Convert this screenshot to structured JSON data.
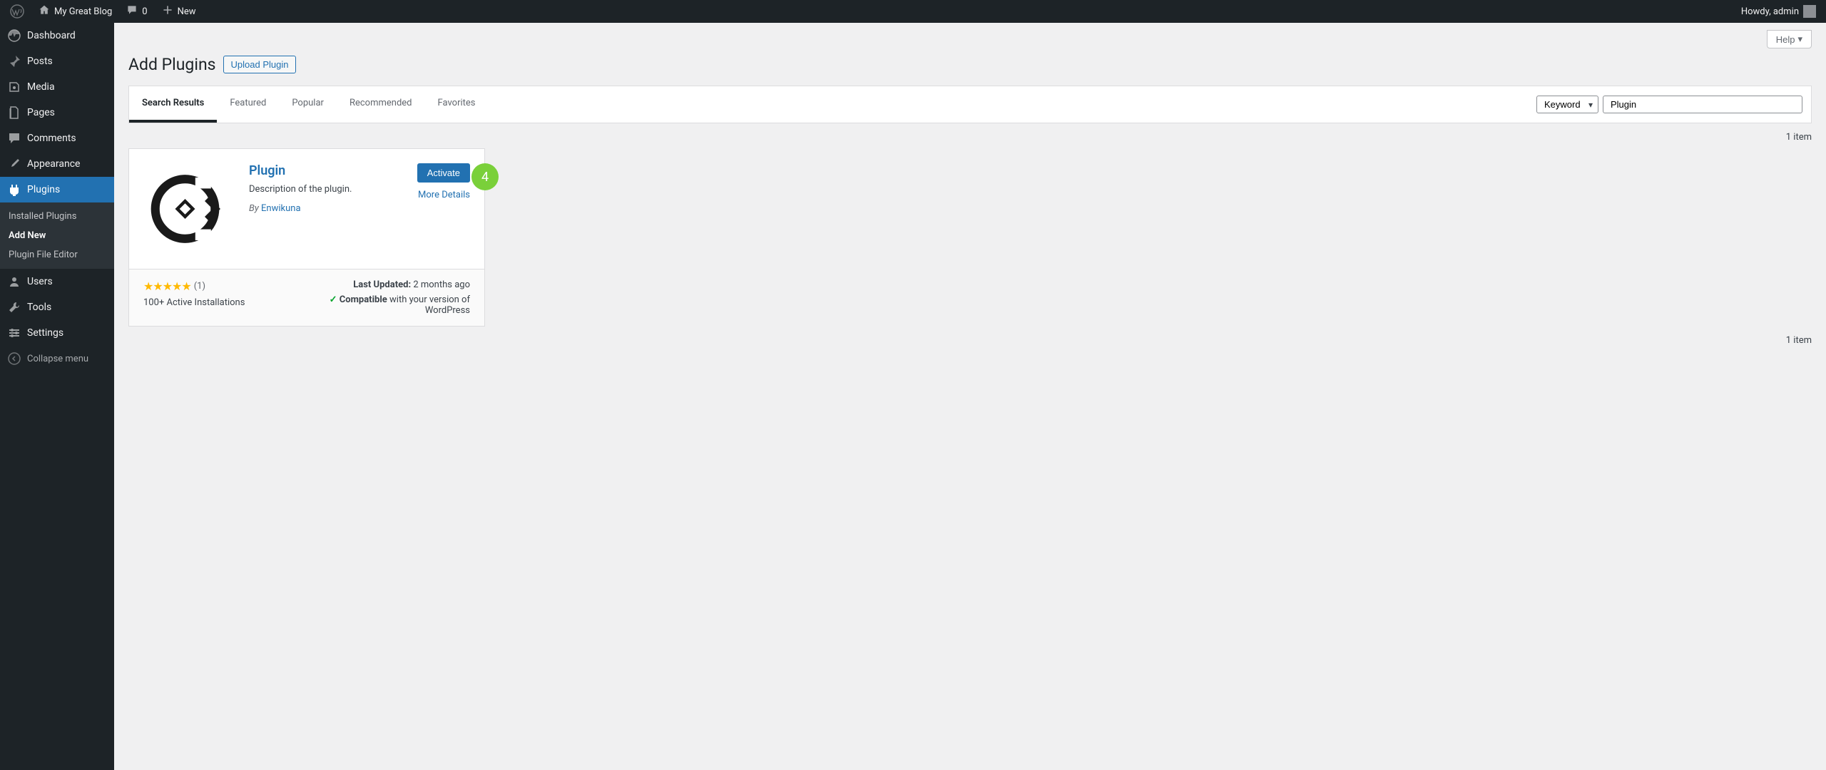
{
  "adminbar": {
    "site_name": "My Great Blog",
    "comments_count": "0",
    "new_label": "New",
    "howdy": "Howdy, admin"
  },
  "sidebar": {
    "dashboard": "Dashboard",
    "posts": "Posts",
    "media": "Media",
    "pages": "Pages",
    "comments": "Comments",
    "appearance": "Appearance",
    "plugins": "Plugins",
    "users": "Users",
    "tools": "Tools",
    "settings": "Settings",
    "collapse": "Collapse menu",
    "submenu": {
      "installed": "Installed Plugins",
      "add_new": "Add New",
      "editor": "Plugin File Editor"
    }
  },
  "page": {
    "title": "Add Plugins",
    "upload_btn": "Upload Plugin",
    "help": "Help"
  },
  "filter": {
    "tabs": {
      "search": "Search Results",
      "featured": "Featured",
      "popular": "Popular",
      "recommended": "Recommended",
      "favorites": "Favorites"
    },
    "search_type": "Keyword",
    "search_value": "Plugin"
  },
  "results": {
    "count": "1 item"
  },
  "plugin": {
    "name": "Plugin",
    "description": "Description of the plugin.",
    "by": "By ",
    "author": "Enwikuna",
    "activate": "Activate",
    "more_details": "More Details",
    "rating_count": "(1)",
    "installs": "100+ Active Installations",
    "updated_label": "Last Updated:",
    "updated_value": " 2 months ago",
    "compat_label": "Compatible",
    "compat_value": " with your version of WordPress",
    "badge": "4"
  }
}
